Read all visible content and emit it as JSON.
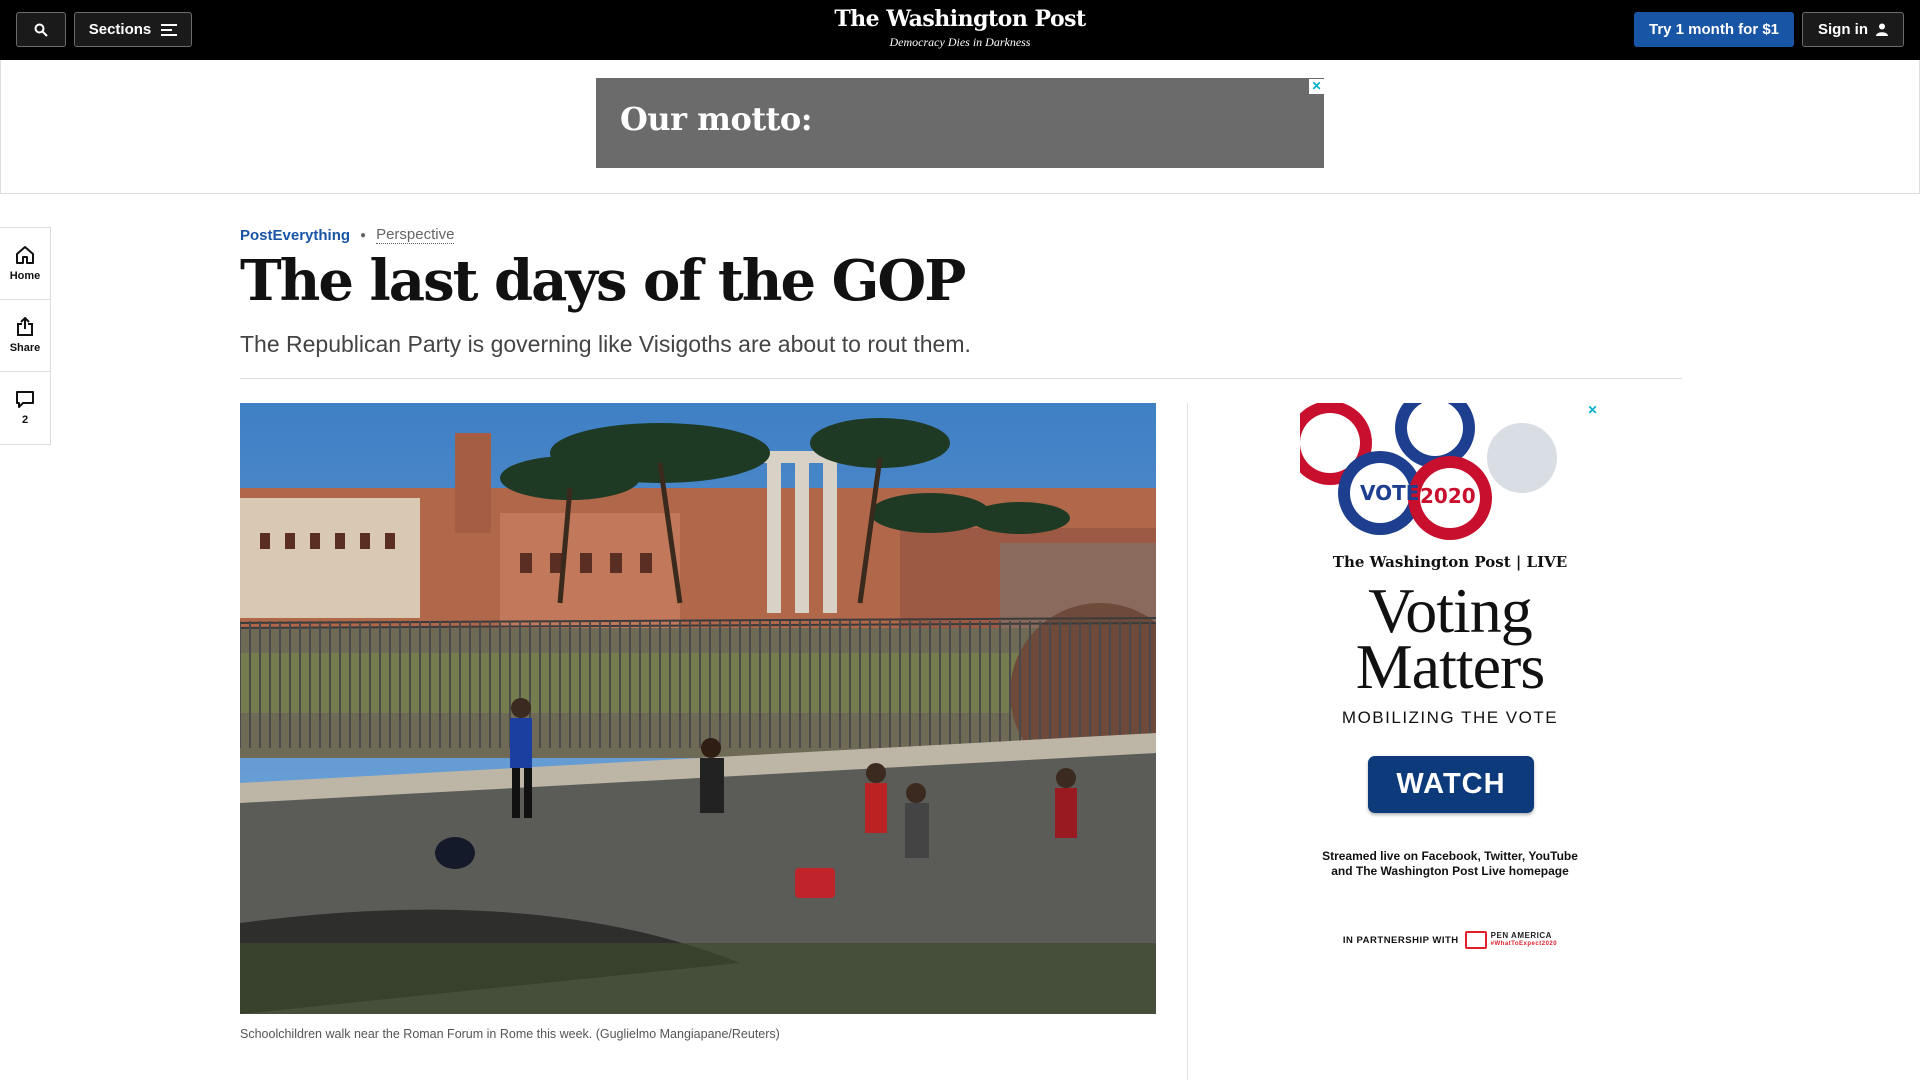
{
  "header": {
    "sections_label": "Sections",
    "logo": "The Washington Post",
    "tagline": "Democracy Dies in Darkness",
    "try_label": "Try 1 month for $1",
    "signin_label": "Sign in"
  },
  "top_ad": {
    "text": "Our motto:"
  },
  "left_rail": {
    "home": "Home",
    "share": "Share",
    "comments_count": "2"
  },
  "article": {
    "section": "PostEverything",
    "label": "Perspective",
    "headline": "The last days of the GOP",
    "dek": "The Republican Party is governing like Visigoths are about to rout them.",
    "caption": "Schoolchildren walk near the Roman Forum in Rome this week. (Guglielmo Mangiapane/Reuters)"
  },
  "right_ad": {
    "brand": "The Washington Post | LIVE",
    "title_line1": "Voting",
    "title_line2": "Matters",
    "subtitle": "MOBILIZING THE VOTE",
    "cta": "WATCH",
    "stream_line1": "Streamed live on Facebook, Twitter, YouTube",
    "stream_line2": "and The Washington Post Live homepage",
    "partner": "IN PARTNERSHIP WITH",
    "partner_name": "PEN AMERICA",
    "partner_tag": "#WhatToExpect2020"
  },
  "colors": {
    "accent": "#1955a5",
    "header_bg": "#000000",
    "ad_gray": "#6b6b6b",
    "watch_blue": "#0d3a7a"
  }
}
